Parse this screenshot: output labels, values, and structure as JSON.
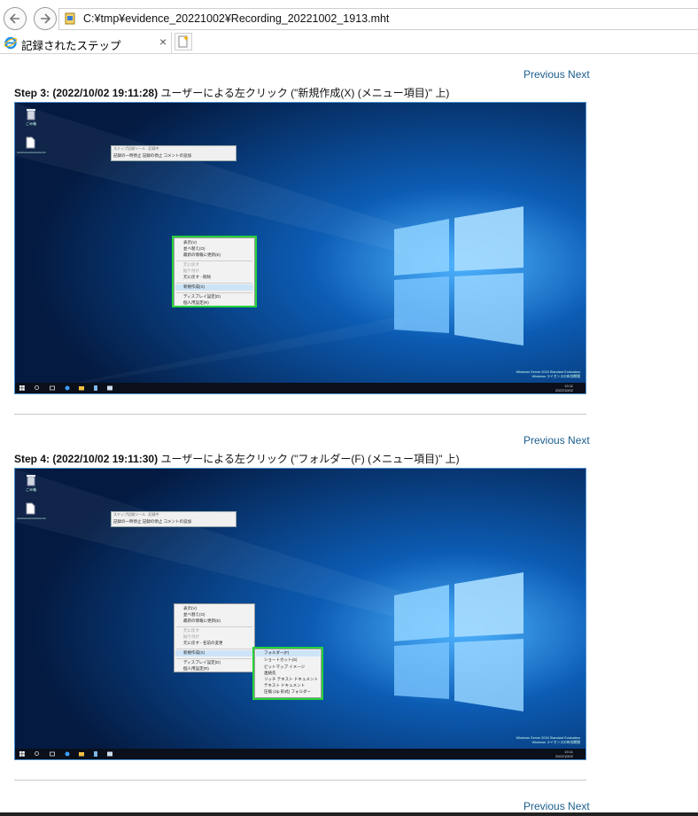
{
  "browser": {
    "address": "C:¥tmp¥evidence_20221002¥Recording_20221002_1913.mht",
    "tab_title": "記録されたステップ",
    "tab_close": "×"
  },
  "links": {
    "previous": "Previous",
    "next": "Next"
  },
  "steps": [
    {
      "title_bold": "Step 3: (2022/10/02 19:11:28)",
      "title_rest": " ユーザーによる左クリック (\"新規作成(X) (メニュー項目)\" 上)",
      "toolbar_title": "ステップ記録ツール - 記録中",
      "toolbar_items": "記録の一時停止  記録の停止  コメントの追加",
      "menu_items": [
        "表示(V)",
        "並べ替え(O)",
        "最新の情報に更新(E)",
        "元に戻す",
        "貼り付け",
        "ショートカットの貼り付け",
        "元に戻す - 削除",
        "新規作成(X)",
        "ディスプレイ設定(D)",
        "個人用設定(R)"
      ],
      "submenu_items": []
    },
    {
      "title_bold": "Step 4: (2022/10/02 19:11:30)",
      "title_rest": " ユーザーによる左クリック (\"フォルダー(F) (メニュー項目)\" 上)",
      "toolbar_title": "ステップ記録ツール - 記録中",
      "toolbar_items": "記録の一時停止  記録の停止  コメントの追加",
      "menu_items": [
        "表示(V)",
        "並べ替え(O)",
        "最新の情報に更新(E)",
        "元に戻す",
        "貼り付け",
        "ショートカットの貼り付け",
        "元に戻す - 名前の変更",
        "新規作成(X)",
        "ディスプレイ設定(D)",
        "個人用設定(R)"
      ],
      "submenu_items": [
        "フォルダー(F)",
        "ショートカット(S)",
        "ビットマップ イメージ",
        "連絡先",
        "リッチ テキスト ドキュメント",
        "テキスト ドキュメント",
        "圧縮 (zip 形式) フォルダー"
      ]
    }
  ],
  "desktop": {
    "recycle_bin": "ごみ箱",
    "file_label": "xxxxxxxxxxxxxxxxxxx.txt",
    "watermark_1": "Windows Server 2016 Standard Evaluation",
    "watermark_2": "Windows ライセンスの有効期間",
    "clock_time": "19:11",
    "clock_date": "2022/10/02"
  },
  "colors": {
    "link": "#1b5e8d",
    "highlight": "#27d33a",
    "frame": "#4a90d0"
  }
}
